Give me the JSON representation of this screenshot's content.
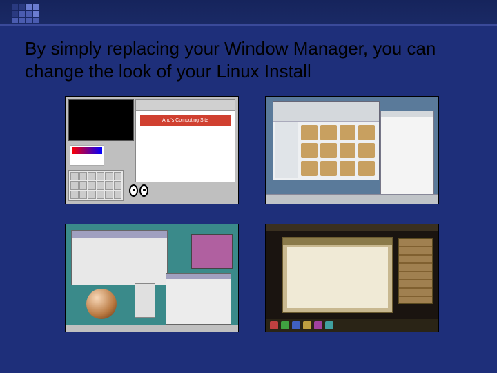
{
  "title": "By simply replacing your Window Manager, you can change the look of your Linux Install",
  "thumbs": {
    "t1": {
      "banner": "And's Computing Site"
    }
  }
}
